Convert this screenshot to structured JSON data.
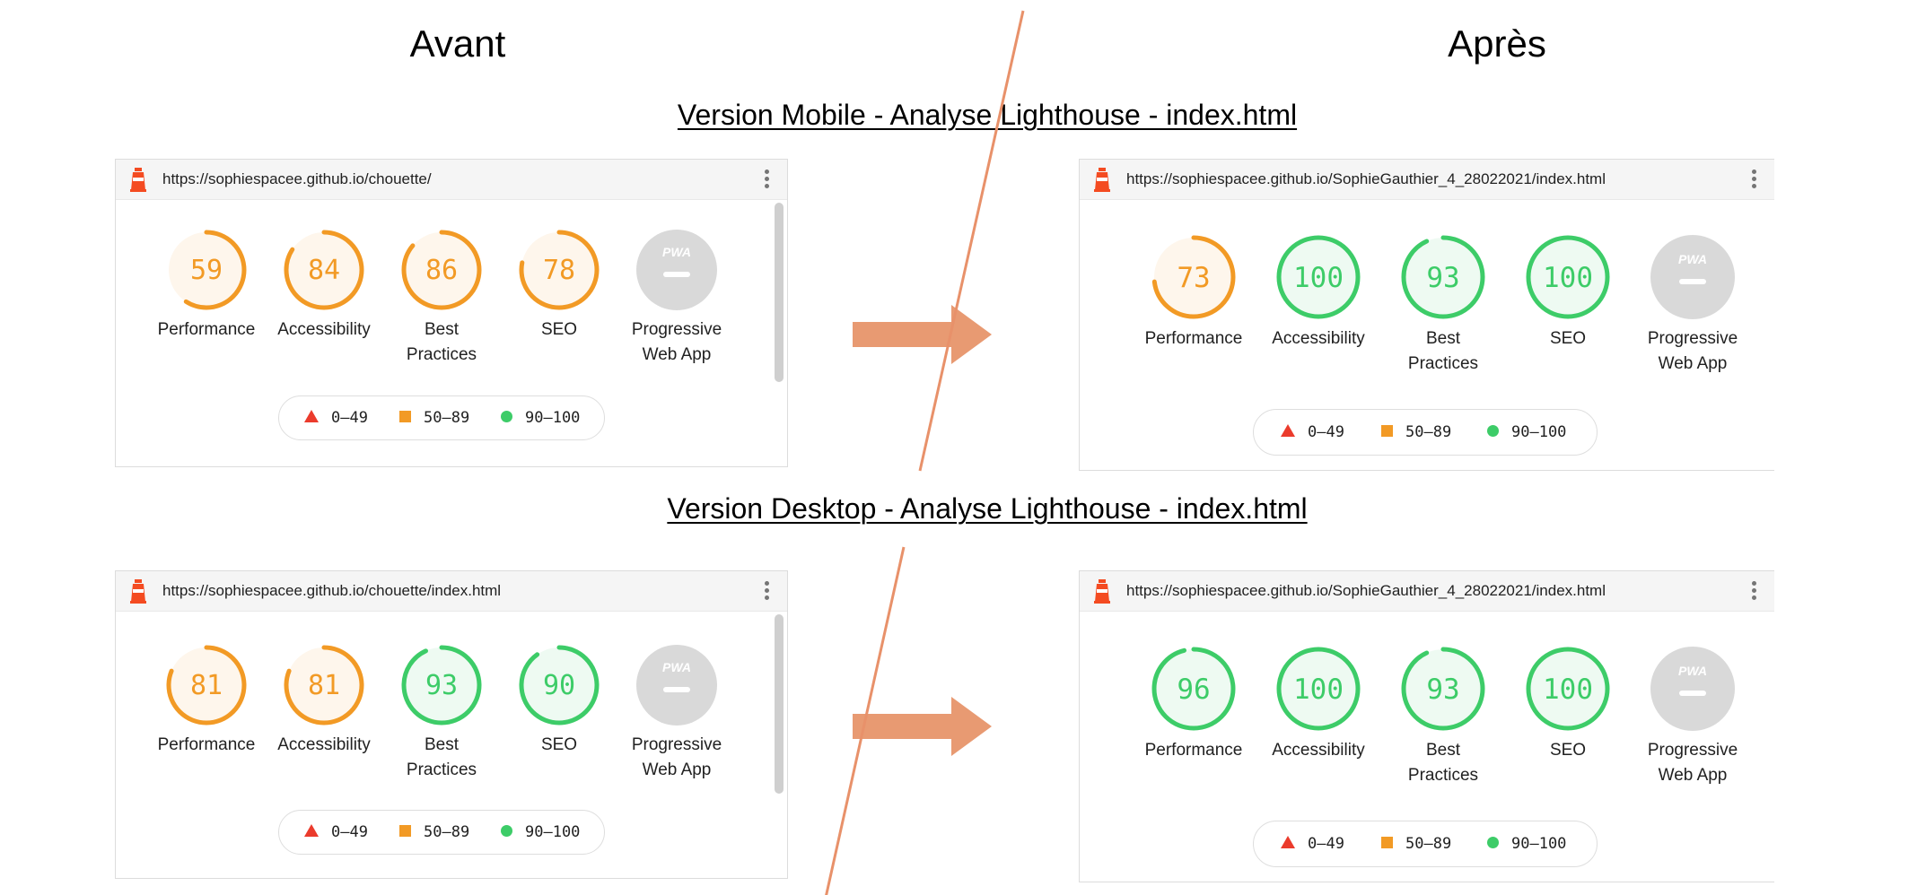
{
  "header": {
    "before": "Avant",
    "after": "Après"
  },
  "sections": {
    "mobile_title": "Version Mobile - Analyse Lighthouse - index.html",
    "desktop_title": "Version Desktop - Analyse Lighthouse - index.html"
  },
  "colors": {
    "fail": "#eb3b2c",
    "average": "#f29a25",
    "pass": "#3dcc68",
    "pwa": "#d9d9d9",
    "arrow": "#e89a72",
    "divider": "#e8916a"
  },
  "legend": {
    "fail": "0–49",
    "average": "50–89",
    "pass": "90–100"
  },
  "labels": {
    "performance": "Performance",
    "accessibility": "Accessibility",
    "best_practices_1": "Best",
    "best_practices_2": "Practices",
    "seo": "SEO",
    "pwa_1": "Progressive",
    "pwa_2": "Web App",
    "pwa_badge": "PWA"
  },
  "panels": {
    "mobile_before": {
      "url": "https://sophiespacee.github.io/chouette/",
      "scores": {
        "performance": "59",
        "accessibility": "84",
        "best_practices": "86",
        "seo": "78"
      }
    },
    "mobile_after": {
      "url": "https://sophiespacee.github.io/SophieGauthier_4_28022021/index.html",
      "scores": {
        "performance": "73",
        "accessibility": "100",
        "best_practices": "93",
        "seo": "100"
      }
    },
    "desktop_before": {
      "url": "https://sophiespacee.github.io/chouette/index.html",
      "scores": {
        "performance": "81",
        "accessibility": "81",
        "best_practices": "93",
        "seo": "90"
      }
    },
    "desktop_after": {
      "url": "https://sophiespacee.github.io/SophieGauthier_4_28022021/index.html",
      "scores": {
        "performance": "96",
        "accessibility": "100",
        "best_practices": "93",
        "seo": "100"
      }
    }
  }
}
